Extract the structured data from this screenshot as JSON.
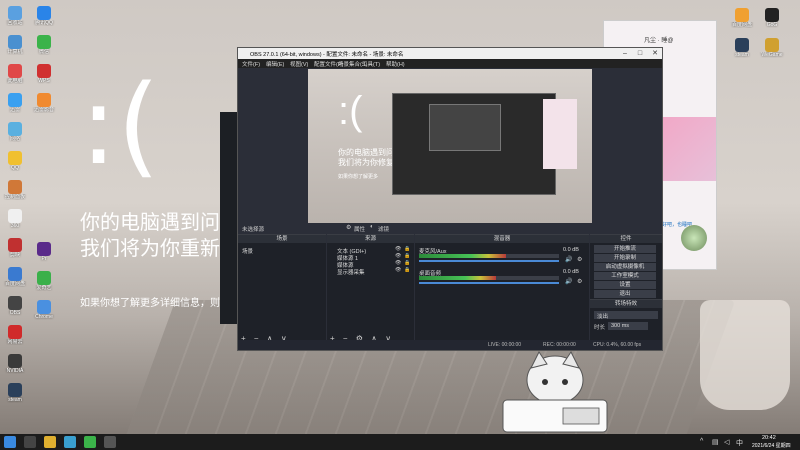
{
  "desktop": {
    "icons_left": [
      {
        "label": "回收站",
        "color": "#5aa0e0"
      },
      {
        "label": "计算机",
        "color": "#4a90d0"
      },
      {
        "label": "此电脑",
        "color": "#e04848"
      },
      {
        "label": "迅雷",
        "color": "#3aa0f0"
      },
      {
        "label": "网络",
        "color": "#5ab0e0"
      },
      {
        "label": "QQ",
        "color": "#f0c030"
      },
      {
        "label": "控制面板",
        "color": "#d07838"
      },
      {
        "label": "360",
        "color": "#f0f0f0"
      },
      {
        "label": "剪映",
        "color": "#c03030"
      },
      {
        "label": "百度网盘",
        "color": "#3a7ad0"
      },
      {
        "label": "OBS",
        "color": "#444"
      },
      {
        "label": "网易云",
        "color": "#d02a2a"
      },
      {
        "label": "NVIDIA",
        "color": "#3a3a3a"
      },
      {
        "label": "steam",
        "color": "#2a3f5a"
      }
    ],
    "icons_col2": [
      {
        "label": "腾讯QQ",
        "color": "#2a84e8"
      },
      {
        "label": "微信",
        "color": "#3bb34a"
      },
      {
        "label": "WPS",
        "color": "#d03030"
      },
      {
        "label": "迅雷影音",
        "color": "#f08a30"
      },
      {
        "label": "Pr",
        "color": "#5a2a8a"
      },
      {
        "label": "爱奇艺",
        "color": "#3ab04a"
      },
      {
        "label": "Chrome",
        "color": "#4a90e0"
      }
    ],
    "icons_right": [
      {
        "label": "百度网盘",
        "color": "#f0a030"
      },
      {
        "label": "steam",
        "color": "#2a3f5a"
      },
      {
        "label": "GoG",
        "color": "#222"
      },
      {
        "label": "WeGame",
        "color": "#d0a030"
      }
    ]
  },
  "bsod": {
    "face": ":(",
    "line1": "你的电脑遇到问",
    "line2": "我们将为你重新",
    "more": "如果你想了解更多详细信息，则"
  },
  "chat": {
    "title": "凡尘 · 睡@",
    "reply": "好吧，也睡吧"
  },
  "obs": {
    "title": "OBS 27.0.1 (64-bit, windows) - 配置文件: 未命名 - 场景: 未命名",
    "menus": [
      "文件(F)",
      "编辑(E)",
      "视图(V)",
      "配置文件(P)",
      "场景集合(S)",
      "工具(T)",
      "帮助(H)"
    ],
    "preview": {
      "face": ":(",
      "line1": "你的电脑遇到问",
      "line2": "我们将为你修复",
      "note": "如果你想了解更多"
    },
    "no_source": "未选择源",
    "properties_btn": "属性",
    "filters_btn": "滤镜",
    "scenes": {
      "header": "场景",
      "items": [
        "场景"
      ]
    },
    "sources": {
      "header": "来源",
      "items": [
        "文本 (GDI+)",
        "媒体源 1",
        "媒体源",
        "显示器采集"
      ]
    },
    "mixer": {
      "header": "混音器",
      "channels": [
        {
          "name": "麦克风/Aux",
          "db": "0.0 dB",
          "level": 0.62
        },
        {
          "name": "桌面音频",
          "db": "0.0 dB",
          "level": 0.55
        }
      ]
    },
    "transitions": {
      "header": "转场特效",
      "type": "淡出",
      "duration_label": "时长",
      "duration": "300 ms"
    },
    "controls": {
      "header": "控件",
      "buttons": [
        "开始推流",
        "开始录制",
        "启动虚拟摄像机",
        "工作室模式",
        "设置",
        "退出"
      ]
    },
    "status": {
      "live": "LIVE: 00:00:00",
      "rec": "REC: 00:00:00",
      "cpu": "CPU: 0.4%, 60.00 fps"
    }
  },
  "taskbar": {
    "apps": [
      {
        "name": "windows-start",
        "color": "#3a8ae0"
      },
      {
        "name": "search",
        "color": "#444"
      },
      {
        "name": "explorer",
        "color": "#e0b030"
      },
      {
        "name": "edge",
        "color": "#3aa0d0"
      },
      {
        "name": "wechat",
        "color": "#3bb34a"
      },
      {
        "name": "obs",
        "color": "#555"
      }
    ],
    "time": "20:42",
    "date": "2021/6/24 星期四"
  }
}
